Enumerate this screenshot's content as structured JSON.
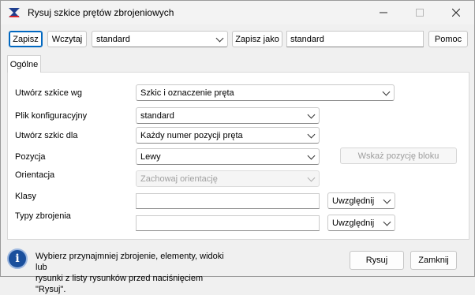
{
  "window": {
    "title": "Rysuj szkice prętów zbrojeniowych"
  },
  "toolbar": {
    "save_label": "Zapisz",
    "load_label": "Wczytaj",
    "preset_value": "standard",
    "save_as_label": "Zapisz jako",
    "save_as_name": "standard",
    "help_label": "Pomoc"
  },
  "tabs": [
    {
      "label": "Ogólne"
    }
  ],
  "form": {
    "create_sketches_by": {
      "label": "Utwórz szkice wg",
      "value": "Szkic i oznaczenie pręta"
    },
    "config_file": {
      "label": "Plik konfiguracyjny",
      "value": "standard"
    },
    "create_sketch_for": {
      "label": "Utwórz szkic dla",
      "value": "Każdy numer pozycji pręta"
    },
    "position": {
      "label": "Pozycja",
      "value": "Lewy"
    },
    "block_position_button": "Wskaż pozycję bloku",
    "orientation": {
      "label": "Orientacja",
      "value": "Zachowaj orientację"
    },
    "classes": {
      "label": "Klasy",
      "value": "",
      "filter": "Uwzględnij"
    },
    "rebar_types": {
      "label": "Typy zbrojenia",
      "value": "",
      "filter": "Uwzględnij"
    }
  },
  "footer": {
    "info_line1": "Wybierz przynajmniej zbrojenie, elementy, widoki lub",
    "info_line2": "rysunki z listy rysunków przed naciśnięciem \"Rysuj\".",
    "draw_label": "Rysuj",
    "close_label": "Zamknij"
  },
  "colors": {
    "accent": "#0067c0",
    "info_icon": "#1a4f9c",
    "app_icon_blue": "#1f3f8f",
    "app_icon_red": "#d8262c"
  }
}
